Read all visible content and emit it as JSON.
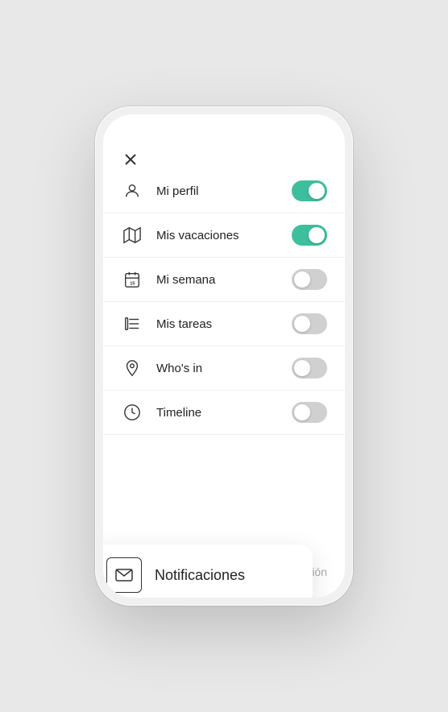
{
  "phone": {
    "menu": {
      "close_label": "×",
      "items": [
        {
          "id": "mi-perfil",
          "label": "Mi perfil",
          "icon": "user",
          "toggle": "on"
        },
        {
          "id": "mis-vacaciones",
          "label": "Mis vacaciones",
          "icon": "map",
          "toggle": "on"
        },
        {
          "id": "mi-semana",
          "label": "Mi semana",
          "icon": "calendar",
          "toggle": "off"
        },
        {
          "id": "mis-tareas",
          "label": "Mis tareas",
          "icon": "list",
          "toggle": "off"
        },
        {
          "id": "whos-in",
          "label": "Who's in",
          "icon": "location",
          "toggle": "off"
        },
        {
          "id": "timeline",
          "label": "Timeline",
          "icon": "clock",
          "toggle": "off"
        }
      ],
      "logout_label": "Cerrar sesión"
    },
    "notification": {
      "label": "Notificaciones",
      "icon": "mail"
    }
  }
}
